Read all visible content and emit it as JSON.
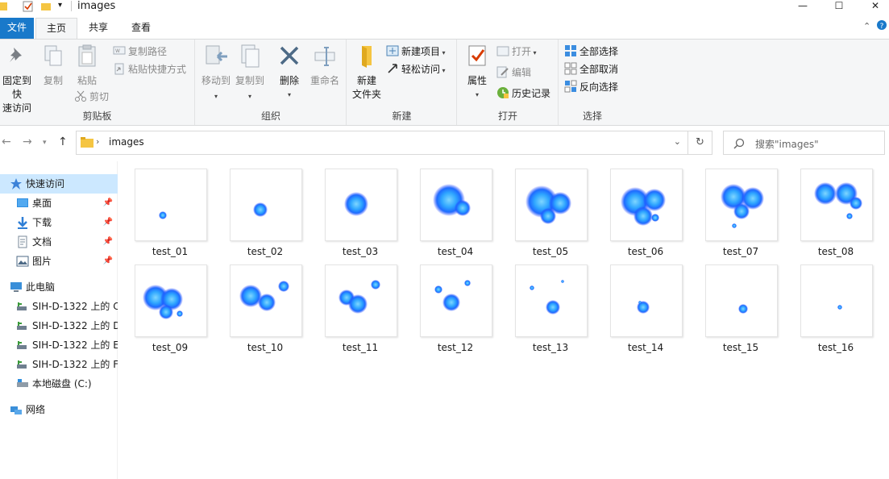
{
  "window": {
    "title": "images",
    "minimize": "—",
    "maximize": "☐",
    "close": "✕"
  },
  "tabs": {
    "file": "文件",
    "home": "主页",
    "share": "共享",
    "view": "查看"
  },
  "ribbon": {
    "clipboard": {
      "label": "剪贴板",
      "pin_line1": "固定到快",
      "pin_line2": "速访问",
      "copy": "复制",
      "paste": "粘贴",
      "copy_path": "复制路径",
      "paste_shortcut": "粘贴快捷方式",
      "cut": "剪切"
    },
    "organize": {
      "label": "组织",
      "move_to": "移动到",
      "copy_to": "复制到",
      "delete": "删除",
      "rename": "重命名"
    },
    "new": {
      "label": "新建",
      "new_folder_line1": "新建",
      "new_folder_line2": "文件夹",
      "new_item": "新建项目",
      "easy_access": "轻松访问"
    },
    "open": {
      "label": "打开",
      "properties": "属性",
      "open": "打开",
      "edit": "编辑",
      "history": "历史记录"
    },
    "select": {
      "label": "选择",
      "select_all": "全部选择",
      "select_none": "全部取消",
      "invert": "反向选择"
    }
  },
  "address": {
    "path": "images",
    "search_placeholder": "搜索\"images\""
  },
  "nav": {
    "quick_access": "快速访问",
    "desktop": "桌面",
    "downloads": "下载",
    "documents": "文档",
    "pictures": "图片",
    "this_pc": "此电脑",
    "drive1": "SIH-D-1322 上的 C",
    "drive2": "SIH-D-1322 上的 D",
    "drive3": "SIH-D-1322 上的 E",
    "drive4": "SIH-D-1322 上的 F",
    "local_disk": "本地磁盘 (C:)",
    "network": "网络"
  },
  "files": [
    "test_01",
    "test_02",
    "test_03",
    "test_04",
    "test_05",
    "test_06",
    "test_07",
    "test_08",
    "test_09",
    "test_10",
    "test_11",
    "test_12",
    "test_13",
    "test_14",
    "test_15",
    "test_16"
  ],
  "colors": {
    "accent": "#1979ca",
    "selection": "#cce8ff",
    "flame_core": "#1e6bff",
    "flame_glow": "#7fd6ff"
  }
}
